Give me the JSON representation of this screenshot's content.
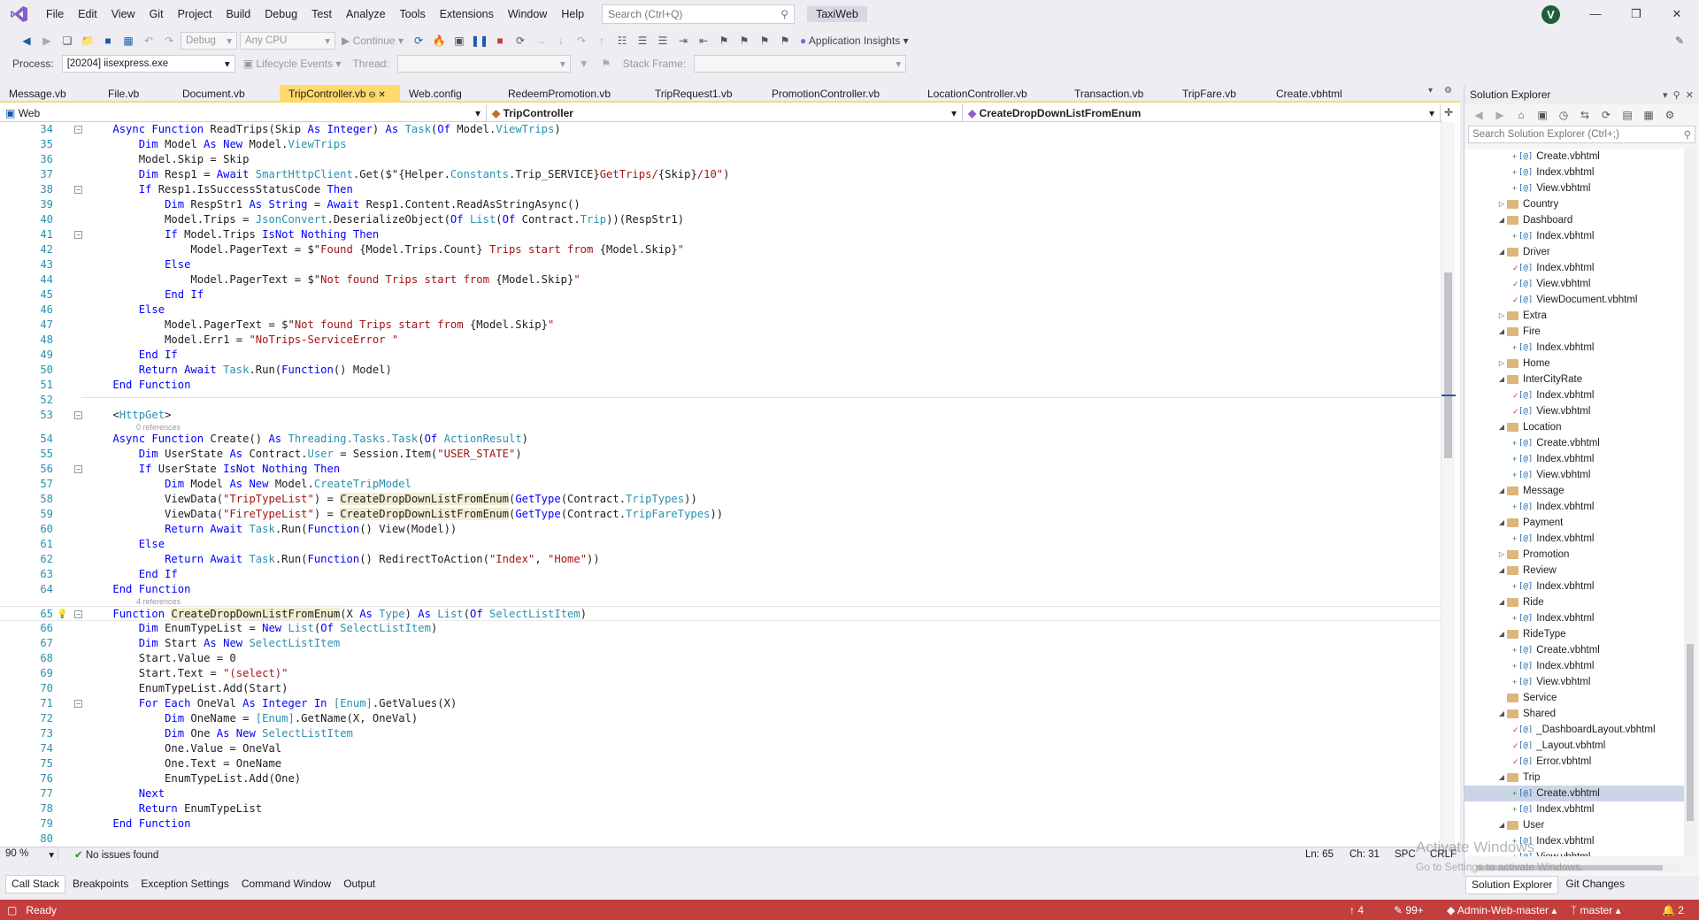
{
  "menu": [
    "File",
    "Edit",
    "View",
    "Git",
    "Project",
    "Build",
    "Debug",
    "Test",
    "Analyze",
    "Tools",
    "Extensions",
    "Window",
    "Help"
  ],
  "search": {
    "placeholder": "Search (Ctrl+Q)"
  },
  "app_title": "TaxiWeb",
  "user_initial": "V",
  "toolbar": {
    "config": "Debug",
    "platform": "Any CPU",
    "continue_label": "Continue",
    "app_insights": "Application Insights",
    "process_label": "Process:",
    "process_value": "[20204] iisexpress.exe",
    "lifecycle": "Lifecycle Events",
    "thread_label": "Thread:",
    "stack_frame_label": "Stack Frame:"
  },
  "tabs": [
    "Message.vb",
    "File.vb",
    "Document.vb",
    "TripController.vb",
    "Web.config",
    "RedeemPromotion.vb",
    "TripRequest1.vb",
    "PromotionController.vb",
    "LocationController.vb",
    "Transaction.vb",
    "TripFare.vb",
    "Create.vbhtml"
  ],
  "active_tab_index": 3,
  "nav": {
    "project": "Web",
    "class": "TripController",
    "member": "CreateDropDownListFromEnum"
  },
  "code_lens": {
    "zero_refs": "0 references",
    "four_refs": "4 references"
  },
  "status_row": {
    "zoom": "90 %",
    "issues": "No issues found",
    "ln": "Ln: 65",
    "ch": "Ch: 31",
    "spc": "SPC",
    "crlf": "CRLF"
  },
  "tool_tabs": [
    "Call Stack",
    "Breakpoints",
    "Exception Settings",
    "Command Window",
    "Output"
  ],
  "solution_explorer": {
    "title": "Solution Explorer",
    "search_placeholder": "Search Solution Explorer (Ctrl+;)",
    "tabs": [
      "Solution Explorer",
      "Git Changes"
    ]
  },
  "watermark": {
    "line1": "Activate Windows",
    "line2": "Go to Settings to activate Windows."
  },
  "statusbar": {
    "ready": "Ready",
    "up_count": "4",
    "pending": "99+",
    "repo": "Admin-Web-master",
    "branch": "master",
    "notifications": "2"
  }
}
